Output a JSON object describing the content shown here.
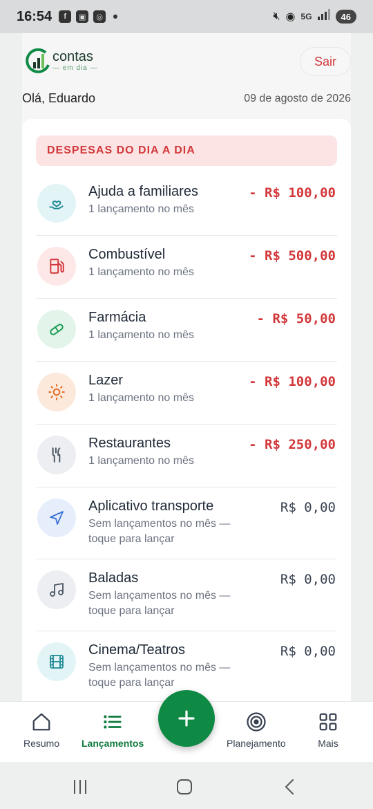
{
  "status_bar": {
    "time": "16:54",
    "battery": "46",
    "network": "5G"
  },
  "app": {
    "logo_main": "contas",
    "logo_sub": "em dia",
    "logout_label": "Sair",
    "greeting": "Olá, Eduardo",
    "date": "09 de agosto de 2026"
  },
  "section": {
    "title": "DESPESAS DO DIA A DIA"
  },
  "categories": [
    {
      "name": "Ajuda a familiares",
      "sub": "1 lançamento no mês",
      "amount": "- R$ 100,00",
      "icon": "hand-heart-icon",
      "bg": "#e3f4f7",
      "color": "#1f8a95"
    },
    {
      "name": "Combustível",
      "sub": "1 lançamento no mês",
      "amount": "- R$ 500,00",
      "icon": "fuel-icon",
      "bg": "#fde7e7",
      "color": "#d2373a"
    },
    {
      "name": "Farmácia",
      "sub": "1 lançamento no mês",
      "amount": "- R$ 50,00",
      "icon": "pill-icon",
      "bg": "#e3f5ea",
      "color": "#1a9a52"
    },
    {
      "name": "Lazer",
      "sub": "1 lançamento no mês",
      "amount": "- R$ 100,00",
      "icon": "sun-icon",
      "bg": "#fde9dc",
      "color": "#e06a22"
    },
    {
      "name": "Restaurantes",
      "sub": "1 lançamento no mês",
      "amount": "- R$ 250,00",
      "icon": "utensils-icon",
      "bg": "#eceef1",
      "color": "#4b5563"
    },
    {
      "name": "Aplicativo transporte",
      "sub": "Sem lançamentos no mês — toque para lançar",
      "amount": "R$ 0,00",
      "icon": "navigation-icon",
      "bg": "#e6eefc",
      "color": "#3b6fd6"
    },
    {
      "name": "Baladas",
      "sub": "Sem lançamentos no mês — toque para lançar",
      "amount": "R$ 0,00",
      "icon": "music-icon",
      "bg": "#eceef1",
      "color": "#4b5563"
    },
    {
      "name": "Cinema/Teatros",
      "sub": "Sem lançamentos no mês — toque para lançar",
      "amount": "R$ 0,00",
      "icon": "film-icon",
      "bg": "#e3f4f7",
      "color": "#1f8a95"
    }
  ],
  "bottom_nav": {
    "items": [
      {
        "label": "Resumo",
        "icon": "home-icon"
      },
      {
        "label": "Lançamentos",
        "icon": "list-icon"
      },
      {
        "label": "Planejamento",
        "icon": "target-icon"
      },
      {
        "label": "Mais",
        "icon": "grid-icon"
      }
    ],
    "fab_icon": "plus-icon"
  },
  "colors": {
    "accent_green": "#0e8a45",
    "expense_red": "#d2373a"
  }
}
